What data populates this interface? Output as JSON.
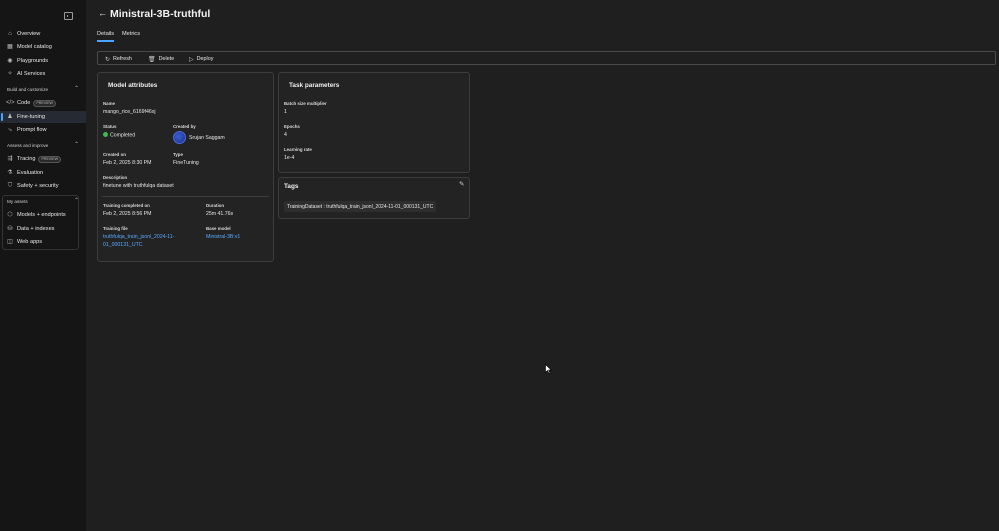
{
  "sidebar": {
    "nav_top": [
      {
        "label": "Overview",
        "icon": "home-icon"
      },
      {
        "label": "Model catalog",
        "icon": "catalog-icon"
      },
      {
        "label": "Playgrounds",
        "icon": "playground-icon"
      },
      {
        "label": "AI Services",
        "icon": "ai-services-icon"
      }
    ],
    "section_build": "Build and customize",
    "nav_build": [
      {
        "label": "Code",
        "badge": "PREVIEW",
        "icon": "code-icon"
      },
      {
        "label": "Fine-tuning",
        "icon": "fine-tuning-icon",
        "selected": true
      },
      {
        "label": "Prompt flow",
        "icon": "prompt-flow-icon"
      }
    ],
    "section_assess": "Assess and improve",
    "nav_assess": [
      {
        "label": "Tracing",
        "badge": "PREVIEW",
        "icon": "tracing-icon"
      },
      {
        "label": "Evaluation",
        "icon": "evaluation-icon"
      },
      {
        "label": "Safety + security",
        "icon": "shield-icon"
      }
    ],
    "section_assets": "My assets",
    "nav_assets": [
      {
        "label": "Models + endpoints",
        "icon": "models-icon"
      },
      {
        "label": "Data + indexes",
        "icon": "data-icon"
      },
      {
        "label": "Web apps",
        "icon": "web-apps-icon"
      }
    ]
  },
  "header": {
    "title": "Ministral-3B-truthful",
    "tabs": [
      {
        "label": "Details",
        "active": true
      },
      {
        "label": "Metrics",
        "active": false
      }
    ]
  },
  "toolbar": {
    "refresh_label": "Refresh",
    "delete_label": "Delete",
    "deploy_label": "Deploy"
  },
  "model_attributes": {
    "title": "Model attributes",
    "name_label": "Name",
    "name_value": "mango_rice_6169f46xj",
    "status_label": "Status",
    "status_value": "Completed",
    "created_by_label": "Created by",
    "created_by_value": "Srujan Saggam",
    "created_on_label": "Created on",
    "created_on_value": "Feb 2, 2025 8:30 PM",
    "type_label": "Type",
    "type_value": "FineTuning",
    "description_label": "Description",
    "description_value": "finetune with truthfulqa dataset",
    "training_completed_label": "Training completed on",
    "training_completed_value": "Feb 2, 2025 8:56 PM",
    "duration_label": "Duration",
    "duration_value": "25m 41.76s",
    "training_file_label": "Training file",
    "training_file_line1": "truthfulqa_train_jsonl_2024-11-",
    "training_file_line2": "01_000131_UTC",
    "base_model_label": "Base model",
    "base_model_value": "Ministral-3B:v1"
  },
  "task_parameters": {
    "title": "Task parameters",
    "batch_label": "Batch size multiplier",
    "batch_value": "1",
    "epochs_label": "Epochs",
    "epochs_value": "4",
    "lr_label": "Learning rate",
    "lr_value": "1e-4"
  },
  "tags": {
    "title": "Tags",
    "items": [
      "TrainingDataset : truthfulqa_train_jsonl_2024-11-01_000131_UTC"
    ]
  },
  "colors": {
    "accent": "#4aa3ff",
    "link": "#5aa9ff",
    "status_ok": "#3fb950",
    "background": "#1f1f1f",
    "sidebar": "#151515"
  }
}
